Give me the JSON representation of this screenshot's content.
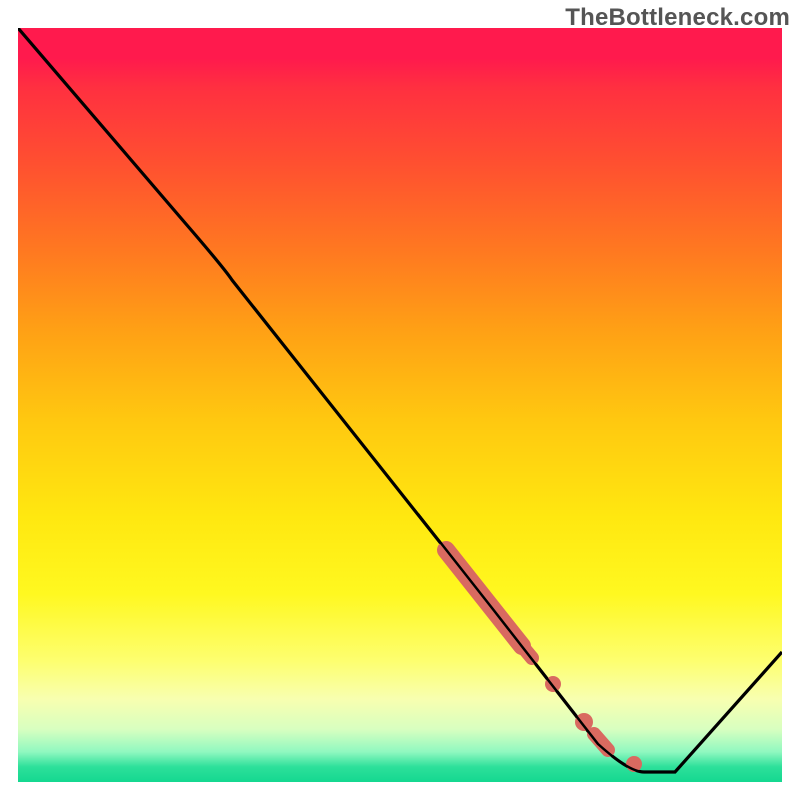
{
  "watermark": "TheBottleneck.com",
  "chart_data": {
    "type": "line",
    "title": "",
    "xlabel": "",
    "ylabel": "",
    "x_range": [
      0,
      100
    ],
    "y_range": [
      0,
      100
    ],
    "background": {
      "description": "vertical gradient, red at top through orange/yellow to green at bottom",
      "stops": [
        {
          "pos": 0.0,
          "color": "#ff1a4d"
        },
        {
          "pos": 0.3,
          "color": "#ff7a20"
        },
        {
          "pos": 0.6,
          "color": "#ffe810"
        },
        {
          "pos": 0.9,
          "color": "#f8ffb0"
        },
        {
          "pos": 1.0,
          "color": "#14d890"
        }
      ]
    },
    "series": [
      {
        "name": "curve",
        "color": "#000000",
        "points": [
          {
            "x": 0,
            "y": 100
          },
          {
            "x": 22,
            "y": 74
          },
          {
            "x": 28,
            "y": 68
          },
          {
            "x": 62,
            "y": 23
          },
          {
            "x": 76,
            "y": 5
          },
          {
            "x": 80,
            "y": 2
          },
          {
            "x": 86,
            "y": 2
          },
          {
            "x": 100,
            "y": 18
          }
        ]
      }
    ],
    "marker_groups": [
      {
        "name": "highlighted-segment",
        "color": "#d96a60",
        "shape": "thick-dash-on-curve",
        "approx_line_width": 12,
        "points": [
          {
            "x": 56,
            "y": 31
          },
          {
            "x": 66,
            "y": 18
          }
        ]
      },
      {
        "name": "highlighted-dots",
        "color": "#d96a60",
        "shape": "circle",
        "radius": 6,
        "points": [
          {
            "x": 70,
            "y": 13
          },
          {
            "x": 74,
            "y": 8
          },
          {
            "x": 76,
            "y": 6
          },
          {
            "x": 80,
            "y": 4
          }
        ]
      }
    ]
  }
}
